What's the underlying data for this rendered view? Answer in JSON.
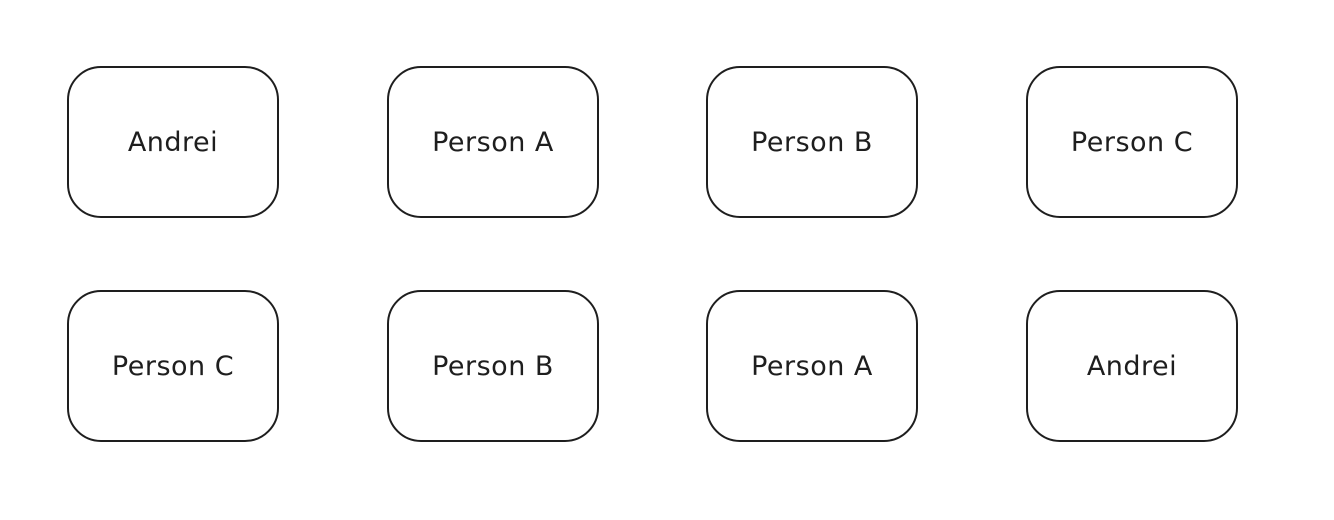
{
  "diagram": {
    "colors": {
      "stroke": "#1e1e1e",
      "background": "#ffffff"
    },
    "rows": [
      {
        "boxes": [
          {
            "label": "Andrei"
          },
          {
            "label": "Person A"
          },
          {
            "label": "Person B"
          },
          {
            "label": "Person C"
          }
        ]
      },
      {
        "boxes": [
          {
            "label": "Person C"
          },
          {
            "label": "Person B"
          },
          {
            "label": "Person A"
          },
          {
            "label": "Andrei"
          }
        ]
      }
    ]
  }
}
